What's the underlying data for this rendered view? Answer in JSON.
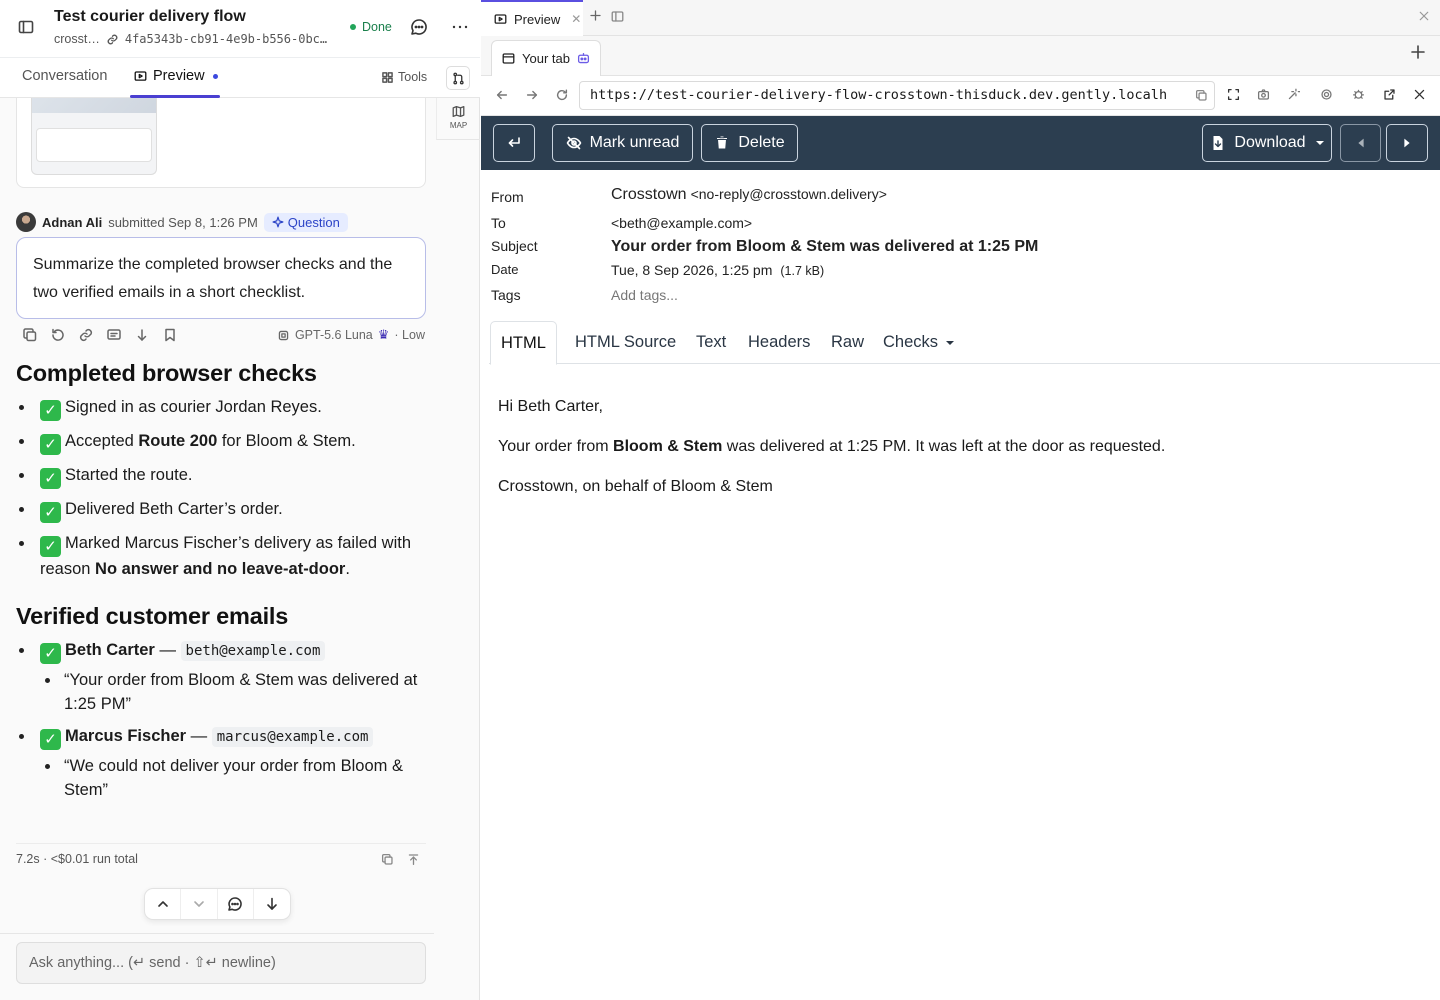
{
  "left": {
    "task_title": "Test courier delivery flow",
    "task_owner": "crosst…",
    "task_id": "4fa5343b-cb91-4e9b-b556-0bc…",
    "status": "Done",
    "tabs": {
      "conversation": "Conversation",
      "preview": "Preview",
      "tools": "Tools"
    },
    "map_label": "MAP",
    "message": {
      "author": "Adnan Ali",
      "submitted": "submitted Sep 8, 1:26 PM",
      "badge": "Question",
      "prompt": "Summarize the completed browser checks and the two verified emails in a short checklist."
    },
    "model": "GPT-5.6 Luna",
    "effort": "· Low",
    "response": {
      "h1": "Completed browser checks",
      "checks": {
        "c1": "Signed in as courier Jordan Reyes.",
        "c2_pre": "Accepted ",
        "c2_bold": "Route 200",
        "c2_post": " for Bloom & Stem.",
        "c3": "Started the route.",
        "c4": "Delivered Beth Carter’s order.",
        "c5_pre": "Marked Marcus Fischer’s delivery as failed with reason ",
        "c5_bold": "No answer and no leave-at-door",
        "c5_post": "."
      },
      "h2": "Verified customer emails",
      "emails": {
        "e1_name": "Beth Carter",
        "e1_dash": " — ",
        "e1_addr": "beth@example.com",
        "e1_subject": "“Your order from Bloom & Stem was delivered at 1:25 PM”",
        "e2_name": "Marcus Fischer",
        "e2_dash": " — ",
        "e2_addr": "marcus@example.com",
        "e2_subject": "“We could not deliver your order from Bloom & Stem”"
      },
      "check_mark": "✓"
    },
    "run_total": "7.2s · <$0.01 run total",
    "ask_placeholder": "Ask anything... (↵ send · ⇧↵ newline)"
  },
  "right": {
    "top_tab": "Preview",
    "browser_tab": "Your tab",
    "url": "https://test-courier-delivery-flow-crosstown-thisduck.dev.gently.localh",
    "toolbar": {
      "mark_unread": "Mark unread",
      "delete": "Delete",
      "download": "Download"
    },
    "email": {
      "labels": {
        "from": "From",
        "to": "To",
        "subject": "Subject",
        "date": "Date",
        "tags": "Tags"
      },
      "from_name": "Crosstown",
      "from_addr": "<no-reply@crosstown.delivery>",
      "to": "<beth@example.com>",
      "subject": "Your order from Bloom & Stem was delivered at 1:25 PM",
      "date": "Tue, 8 Sep 2026, 1:25 pm",
      "size": "(1.7 kB)",
      "tags_placeholder": "Add tags..."
    },
    "mail_tabs": {
      "html": "HTML",
      "html_source": "HTML Source",
      "text": "Text",
      "headers": "Headers",
      "raw": "Raw",
      "checks": "Checks"
    },
    "body": {
      "greeting": "Hi Beth Carter,",
      "p2_pre": "Your order from ",
      "p2_bold": "Bloom & Stem",
      "p2_post": " was delivered at 1:25 PM. It was left at the door as requested.",
      "signoff": "Crosstown, on behalf of Bloom & Stem"
    }
  },
  "colors": {
    "accent": "#4a3fd1",
    "toolbar": "#2c3e50",
    "done": "#22a55a",
    "check": "#2eb84b"
  }
}
